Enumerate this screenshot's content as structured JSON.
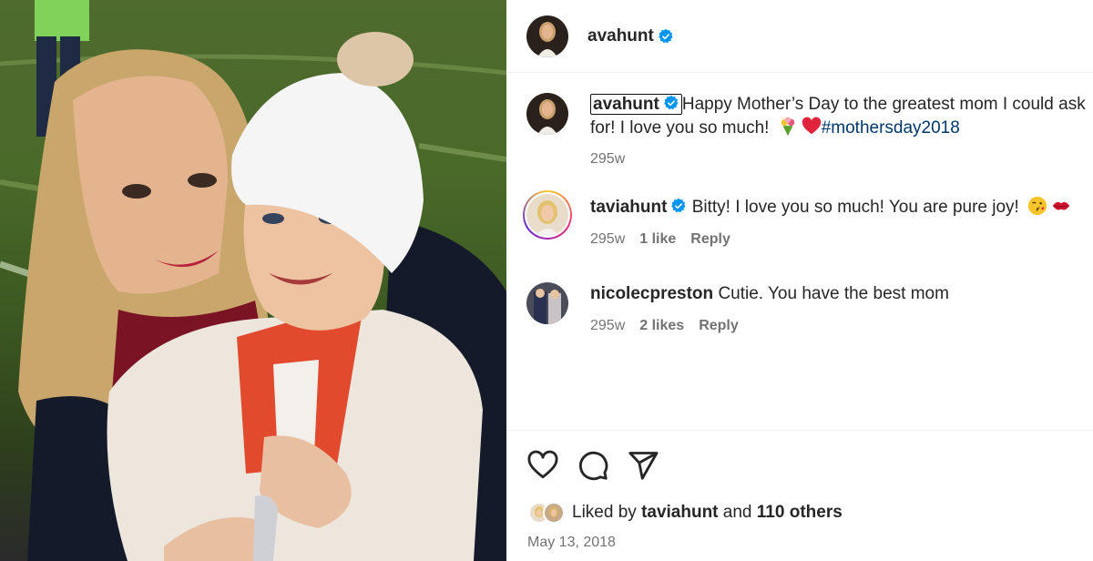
{
  "post": {
    "author": "avahunt",
    "author_verified": true
  },
  "caption": {
    "username": "avahunt",
    "text": "Happy Mother’s Day to the greatest mom I could ask for! I love you so much!",
    "emojis": [
      "bouquet-emoji",
      "red-heart-emoji"
    ],
    "hashtag": "#mothersday2018",
    "time": "295w"
  },
  "comments": [
    {
      "username": "taviahunt",
      "verified": true,
      "text": "Bitty! I love you so much! You are pure joy!",
      "emojis": [
        "face-blowing-kiss-emoji",
        "kiss-lips-emoji"
      ],
      "time": "295w",
      "likes": "1 like",
      "reply": "Reply"
    },
    {
      "username": "nicolecpreston",
      "verified": false,
      "text": "Cutie. You have the best mom",
      "time": "295w",
      "likes": "2 likes",
      "reply": "Reply"
    }
  ],
  "actions": {
    "icons": [
      "heart-icon",
      "comment-icon",
      "share-icon"
    ]
  },
  "likes_line": {
    "prefix": "Liked by",
    "user": "taviahunt",
    "joiner": "and",
    "others": "110 others"
  },
  "date": "May 13, 2018",
  "colors": {
    "verified_blue": "#0095f6",
    "hashtag": "#00376b",
    "muted_text": "#737373",
    "text": "#262626"
  }
}
